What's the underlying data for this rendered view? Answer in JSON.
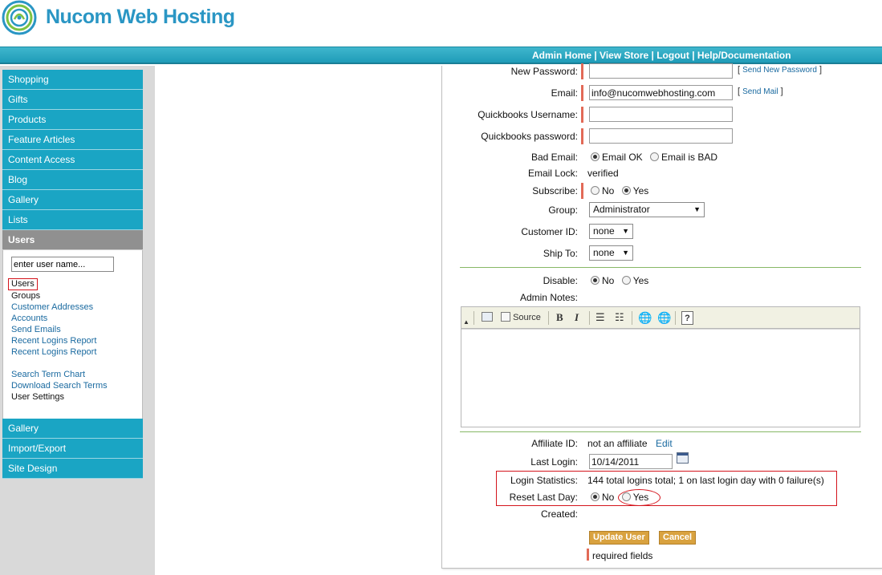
{
  "header": {
    "brand": "Nucom Web Hosting",
    "nav": [
      "Admin Home",
      "View Store",
      "Logout",
      "Help/Documentation"
    ],
    "nav_separator": " | "
  },
  "sidebar": {
    "top_items": [
      "Shopping",
      "Gifts",
      "Products",
      "Feature Articles",
      "Content Access",
      "Blog",
      "Gallery",
      "Lists"
    ],
    "active_item": "Users",
    "search_placeholder": "enter user name...",
    "links": [
      "Users",
      "Groups",
      "Customer Addresses",
      "Accounts",
      "Send Emails",
      "Recent Logins Report",
      "Recent Logins Report"
    ],
    "links2": [
      "Search Term Chart",
      "Download Search Terms",
      "User Settings"
    ],
    "bottom_items": [
      "Gallery",
      "Import/Export",
      "Site Design"
    ]
  },
  "form": {
    "new_password": {
      "label": "New Password:",
      "value": "",
      "action": "Send New Password"
    },
    "email": {
      "label": "Email:",
      "value": "info@nucomwebhosting.com",
      "action": "Send Mail"
    },
    "qb_username": {
      "label": "Quickbooks Username:",
      "value": ""
    },
    "qb_password": {
      "label": "Quickbooks password:",
      "value": ""
    },
    "bad_email": {
      "label": "Bad Email:",
      "opt1": "Email OK",
      "opt2": "Email is BAD",
      "selected": "Email OK"
    },
    "email_lock": {
      "label": "Email Lock:",
      "value": "verified"
    },
    "subscribe": {
      "label": "Subscribe:",
      "opt1": "No",
      "opt2": "Yes",
      "selected": "Yes"
    },
    "group": {
      "label": "Group:",
      "value": "Administrator"
    },
    "customer_id": {
      "label": "Customer ID:",
      "value": "none"
    },
    "ship_to": {
      "label": "Ship To:",
      "value": "none"
    },
    "disable": {
      "label": "Disable:",
      "opt1": "No",
      "opt2": "Yes",
      "selected": "No"
    },
    "admin_notes": {
      "label": "Admin Notes:"
    },
    "editor_toolbar": {
      "source": "Source",
      "bold": "B",
      "italic": "I",
      "help": "?"
    },
    "affiliate": {
      "label": "Affiliate ID:",
      "value": "not an affiliate",
      "action": "Edit"
    },
    "last_login": {
      "label": "Last Login:",
      "value": "10/14/2011"
    },
    "login_stats": {
      "label": "Login Statistics:",
      "value": "144 total logins total; 1 on last login day with 0 failure(s)"
    },
    "reset_last_day": {
      "label": "Reset Last Day:",
      "opt1": "No",
      "opt2": "Yes",
      "selected": "No"
    },
    "created": {
      "label": "Created:",
      "value": ""
    },
    "update_button": "Update User",
    "cancel_button": "Cancel",
    "required_note": "required fields"
  },
  "colors": {
    "accent": "#1aa5c4",
    "button": "#d9a23f",
    "required": "#e26a57",
    "highlight": "#d4141c"
  }
}
